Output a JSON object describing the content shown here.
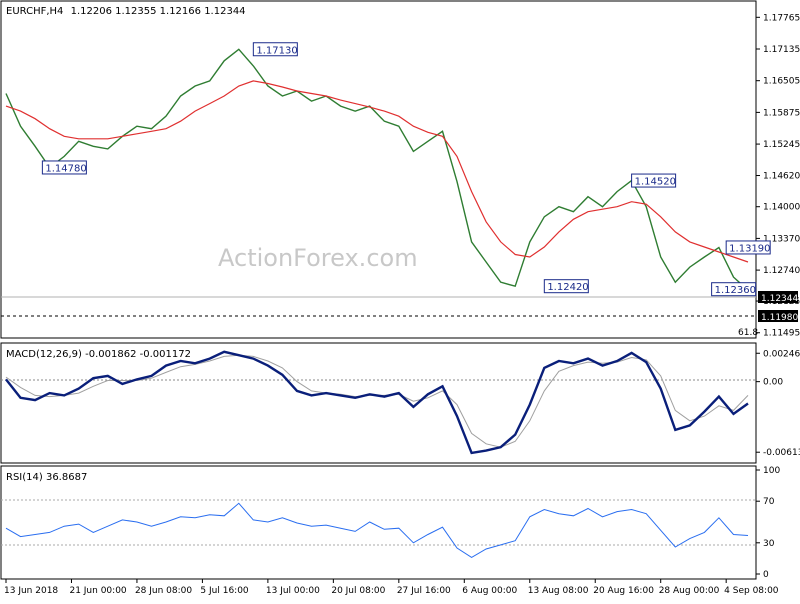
{
  "header": {
    "symbol": "EURCHF,H4",
    "ohlc": "1.12206 1.12355 1.12166 1.12344"
  },
  "watermark": "ActionForex.com",
  "colors": {
    "price": "#2f7d32",
    "ma": "#e03030",
    "macd": "#0a1f7a",
    "signal": "#a0a0a0",
    "rsi": "#2a6ef0",
    "label_border": "#1a2a8a",
    "last_tag_bg": "#000000"
  },
  "price_axis": {
    "ticks": [
      "1.17765",
      "1.17135",
      "1.16505",
      "1.15875",
      "1.15245",
      "1.14620",
      "1.14000",
      "1.13370",
      "1.12740",
      "1.12125",
      "1.11495"
    ],
    "ylim": [
      1.1143,
      1.1795
    ]
  },
  "last_price": "1.12344",
  "support_level": "1.11980",
  "fib_label": "61.8",
  "price_labels": [
    {
      "text": "1.17130",
      "x": 34,
      "y": 1.1713
    },
    {
      "text": "1.14780",
      "x": 5,
      "y": 1.1478
    },
    {
      "text": "1.14520",
      "x": 86,
      "y": 1.1452
    },
    {
      "text": "1.12420",
      "x": 74,
      "y": 1.1242
    },
    {
      "text": "1.13190",
      "x": 99,
      "y": 1.1319
    },
    {
      "text": "1.12360",
      "x": 97,
      "y": 1.1236
    }
  ],
  "x_axis": {
    "labels": [
      "13 Jun 2018",
      "21 Jun 00:00",
      "28 Jun 08:00",
      "5 Jul 16:00",
      "13 Jul 00:00",
      "20 Jul 08:00",
      "27 Jul 16:00",
      "6 Aug 00:00",
      "13 Aug 08:00",
      "20 Aug 16:00",
      "28 Aug 00:00",
      "4 Sep 08:00"
    ],
    "positions": [
      0,
      9,
      18,
      27,
      36,
      45,
      54,
      63,
      72,
      81,
      90,
      99
    ]
  },
  "macd": {
    "label": "MACD(12,26,9) -0.001862 -0.001172",
    "ticks": [
      "0.002469",
      "0.00",
      "-0.006136"
    ],
    "ylim": [
      -0.0069,
      0.0031
    ]
  },
  "rsi": {
    "label": "RSI(14) 36.8687",
    "ticks": [
      "100",
      "70",
      "30",
      "0"
    ]
  },
  "chart_data": {
    "type": "line",
    "title": "EURCHF,H4",
    "x": [
      0,
      2,
      4,
      6,
      8,
      10,
      12,
      14,
      16,
      18,
      20,
      22,
      24,
      26,
      28,
      30,
      32,
      34,
      36,
      38,
      40,
      42,
      44,
      46,
      48,
      50,
      52,
      54,
      56,
      58,
      60,
      62,
      64,
      66,
      68,
      70,
      72,
      74,
      76,
      78,
      80,
      82,
      84,
      86,
      88,
      90,
      92,
      94,
      96,
      98,
      100,
      102
    ],
    "x_labels": [
      "13 Jun 2018",
      "21 Jun 00:00",
      "28 Jun 08:00",
      "5 Jul 16:00",
      "13 Jul 00:00",
      "20 Jul 08:00",
      "27 Jul 16:00",
      "6 Aug 00:00",
      "13 Aug 08:00",
      "20 Aug 16:00",
      "28 Aug 00:00",
      "4 Sep 08:00"
    ],
    "series": [
      {
        "name": "EURCHF",
        "values": [
          1.1625,
          1.156,
          1.152,
          1.1478,
          1.15,
          1.153,
          1.152,
          1.1515,
          1.154,
          1.156,
          1.1555,
          1.158,
          1.162,
          1.164,
          1.165,
          1.169,
          1.1713,
          1.168,
          1.164,
          1.162,
          1.163,
          1.161,
          1.162,
          1.16,
          1.159,
          1.16,
          1.157,
          1.156,
          1.151,
          1.153,
          1.155,
          1.145,
          1.133,
          1.129,
          1.125,
          1.1242,
          1.133,
          1.138,
          1.14,
          1.139,
          1.142,
          1.14,
          1.143,
          1.1452,
          1.14,
          1.13,
          1.125,
          1.128,
          1.13,
          1.1319,
          1.126,
          1.1234
        ]
      },
      {
        "name": "MA",
        "values": [
          1.16,
          1.159,
          1.1575,
          1.1555,
          1.154,
          1.1535,
          1.1535,
          1.1535,
          1.154,
          1.1545,
          1.155,
          1.1555,
          1.157,
          1.159,
          1.1605,
          1.162,
          1.164,
          1.165,
          1.1645,
          1.1638,
          1.163,
          1.1625,
          1.162,
          1.1612,
          1.1605,
          1.1598,
          1.159,
          1.158,
          1.156,
          1.1548,
          1.154,
          1.15,
          1.143,
          1.137,
          1.133,
          1.1305,
          1.13,
          1.132,
          1.135,
          1.1375,
          1.139,
          1.1395,
          1.14,
          1.141,
          1.1405,
          1.138,
          1.135,
          1.133,
          1.132,
          1.131,
          1.13,
          1.129
        ]
      }
    ],
    "macd_values": [
      0.0002,
      -0.0014,
      -0.0016,
      -0.001,
      -0.0012,
      -0.0006,
      0.0003,
      0.0005,
      -0.0002,
      0.0002,
      0.0005,
      0.0014,
      0.0018,
      0.0016,
      0.002,
      0.0026,
      0.0023,
      0.002,
      0.0014,
      0.0006,
      -0.0008,
      -0.0012,
      -0.001,
      -0.0012,
      -0.0014,
      -0.0011,
      -0.0013,
      -0.001,
      -0.0022,
      -0.0011,
      -0.0004,
      -0.003,
      -0.0062,
      -0.006,
      -0.0057,
      -0.0046,
      -0.002,
      0.0012,
      0.0018,
      0.0016,
      0.002,
      0.0014,
      0.0018,
      0.0025,
      0.0017,
      -0.0006,
      -0.0042,
      -0.0038,
      -0.0026,
      -0.0013,
      -0.0028,
      -0.0019
    ],
    "signal_values": [
      0.0004,
      -0.0005,
      -0.0012,
      -0.0013,
      -0.0012,
      -0.001,
      -0.0004,
      0.0001,
      0.0001,
      0.0001,
      0.0003,
      0.0008,
      0.0013,
      0.0015,
      0.0018,
      0.0022,
      0.0023,
      0.0022,
      0.0018,
      0.0012,
      0.0,
      -0.0008,
      -0.001,
      -0.0011,
      -0.0013,
      -0.0012,
      -0.0012,
      -0.0011,
      -0.0017,
      -0.0014,
      -0.0008,
      -0.002,
      -0.0045,
      -0.0054,
      -0.0057,
      -0.0052,
      -0.0034,
      -0.0008,
      0.0009,
      0.0014,
      0.0017,
      0.0016,
      0.0017,
      0.0021,
      0.0019,
      0.0005,
      -0.0025,
      -0.0034,
      -0.003,
      -0.0021,
      -0.0025,
      -0.0012
    ],
    "rsi_values": [
      44,
      36,
      38,
      40,
      46,
      48,
      40,
      46,
      52,
      50,
      46,
      50,
      55,
      54,
      57,
      56,
      68,
      52,
      50,
      54,
      49,
      46,
      47,
      44,
      41,
      50,
      43,
      44,
      30,
      38,
      45,
      25,
      16,
      24,
      28,
      32,
      55,
      62,
      58,
      56,
      63,
      55,
      60,
      62,
      58,
      42,
      26,
      34,
      40,
      54,
      38,
      37
    ],
    "ylabel": ""
  }
}
